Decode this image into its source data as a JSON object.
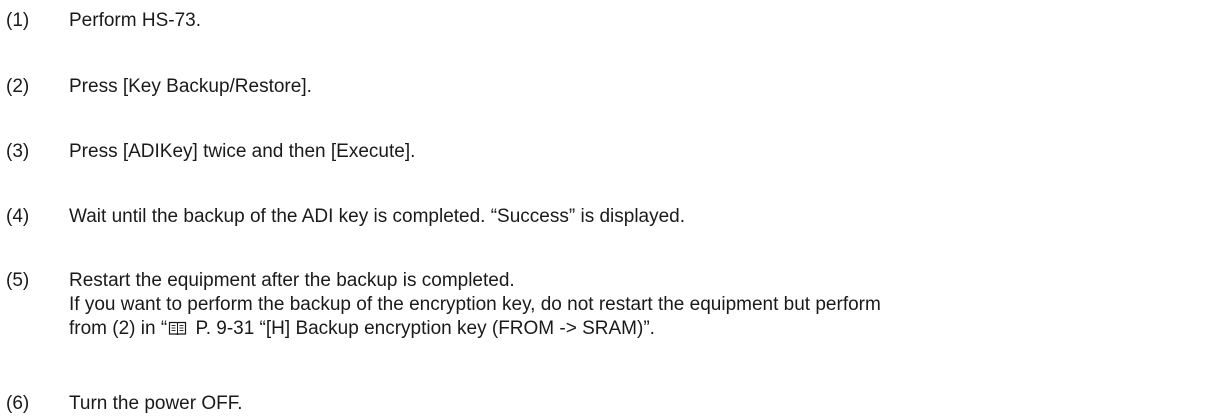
{
  "steps": [
    {
      "number": "(1)",
      "lines": [
        "Perform HS-73."
      ]
    },
    {
      "number": "(2)",
      "lines": [
        "Press [Key Backup/Restore]."
      ]
    },
    {
      "number": "(3)",
      "lines": [
        "Press [ADIKey] twice and then [Execute]."
      ]
    },
    {
      "number": "(4)",
      "lines": [
        "Wait until the backup of the ADI key is completed. “Success” is displayed."
      ]
    },
    {
      "number": "(5)",
      "lines": [
        "Restart the equipment after the backup is completed.",
        "If you want to perform the backup of the encryption key, do not restart the equipment but perform"
      ],
      "ref_prefix": "from (2) in “",
      "ref_icon": "book-reference-icon",
      "ref_text": " P. 9-31 “[H] Backup encryption key (FROM -> SRAM)”."
    },
    {
      "number": "(6)",
      "lines": [
        "Turn the power OFF."
      ]
    }
  ]
}
